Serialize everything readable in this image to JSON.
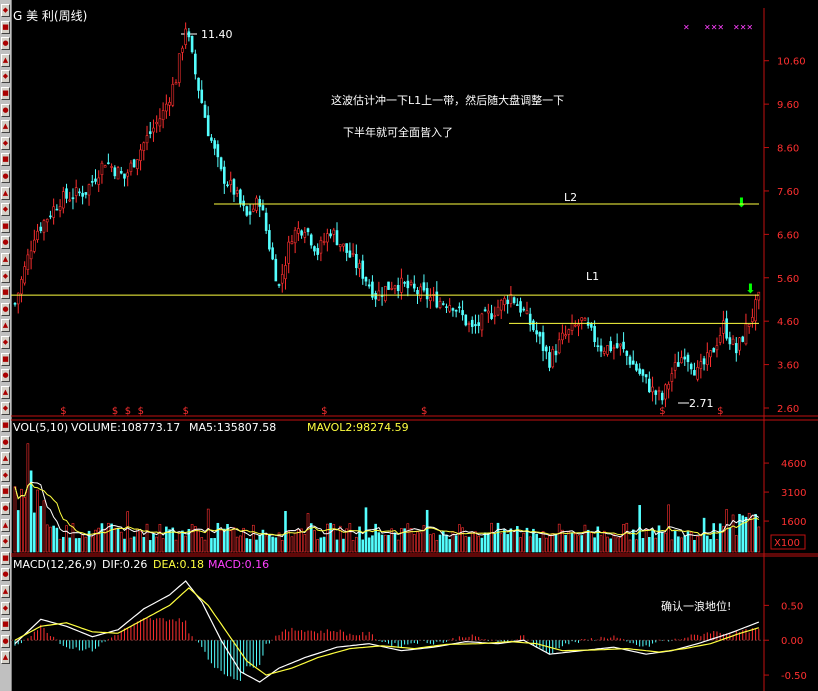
{
  "stock_title": "G 美  利(周线)",
  "price_panel": {
    "peak_label": "11.40",
    "trough_label": "2.71",
    "axis_ticks": [
      "10.60",
      "9.60",
      "8.60",
      "7.60",
      "6.60",
      "5.60",
      "4.60",
      "3.60",
      "2.60"
    ],
    "annotation_line1": "这波估计冲一下L1上一带，然后随大盘调整一下",
    "annotation_line2": "下半年就可全面皆入了",
    "line_labels": {
      "l1": "L1",
      "l2": "L2"
    },
    "marker_glyph": "$"
  },
  "volume_panel": {
    "header_vol": "VOL(5,10)",
    "header_volume": "VOLUME:108773.17",
    "header_ma5": "MA5:135807.58",
    "header_mavol2": "MAVOL2:98274.59",
    "axis_ticks": [
      "4600",
      "3100",
      "1600"
    ],
    "unit_label": "X100"
  },
  "macd_panel": {
    "header_macd": "MACD(12,26,9)",
    "header_dif": "DIF:0.26",
    "header_dea": "DEA:0.18",
    "header_macd_val": "MACD:0.16",
    "axis_ticks": [
      "0.50",
      "0.00",
      "-0.50"
    ],
    "annotation": "确认一浪地位!"
  },
  "colors": {
    "up": "#ff3030",
    "down": "#54ffff",
    "axis": "#c01010",
    "yellow": "#ffff40",
    "white": "#ffffff",
    "magenta": "#ff40ff",
    "green_arrow": "#00ff00"
  },
  "chart_data": {
    "type": "candlestick",
    "price_range": [
      2.6,
      11.4
    ],
    "price_path": [
      [
        0,
        5.0
      ],
      [
        6,
        6.6
      ],
      [
        14,
        7.4
      ],
      [
        22,
        7.6
      ],
      [
        28,
        8.3
      ],
      [
        34,
        7.9
      ],
      [
        40,
        8.7
      ],
      [
        46,
        9.4
      ],
      [
        50,
        10.2
      ],
      [
        53,
        11.4
      ],
      [
        56,
        10.3
      ],
      [
        60,
        9.0
      ],
      [
        64,
        8.0
      ],
      [
        68,
        7.6
      ],
      [
        72,
        7.0
      ],
      [
        76,
        7.4
      ],
      [
        80,
        6.0
      ],
      [
        82,
        5.4
      ],
      [
        86,
        6.6
      ],
      [
        90,
        6.8
      ],
      [
        94,
        6.2
      ],
      [
        98,
        6.7
      ],
      [
        102,
        6.3
      ],
      [
        108,
        5.7
      ],
      [
        112,
        5.2
      ],
      [
        118,
        5.5
      ],
      [
        124,
        5.3
      ],
      [
        130,
        5.1
      ],
      [
        136,
        5.0
      ],
      [
        142,
        4.4
      ],
      [
        148,
        4.8
      ],
      [
        154,
        5.2
      ],
      [
        158,
        4.8
      ],
      [
        162,
        4.3
      ],
      [
        166,
        3.7
      ],
      [
        170,
        4.2
      ],
      [
        176,
        4.6
      ],
      [
        182,
        4.0
      ],
      [
        188,
        4.0
      ],
      [
        194,
        3.4
      ],
      [
        198,
        3.0
      ],
      [
        201,
        2.8
      ],
      [
        204,
        3.4
      ],
      [
        208,
        3.9
      ],
      [
        212,
        3.4
      ],
      [
        216,
        3.8
      ],
      [
        220,
        4.5
      ],
      [
        224,
        3.9
      ],
      [
        228,
        4.6
      ],
      [
        231,
        5.1
      ]
    ],
    "levels": {
      "L1": 5.2,
      "L2": 7.3,
      "support": 4.55
    },
    "volume_range": [
      0,
      6000
    ],
    "macd_range": [
      -0.7,
      0.95
    ],
    "dif_path": [
      [
        0,
        -0.05
      ],
      [
        8,
        0.3
      ],
      [
        16,
        0.2
      ],
      [
        24,
        0.05
      ],
      [
        32,
        0.15
      ],
      [
        40,
        0.45
      ],
      [
        48,
        0.65
      ],
      [
        53,
        0.85
      ],
      [
        58,
        0.55
      ],
      [
        64,
        0.0
      ],
      [
        70,
        -0.45
      ],
      [
        76,
        -0.6
      ],
      [
        82,
        -0.4
      ],
      [
        90,
        -0.25
      ],
      [
        100,
        -0.1
      ],
      [
        110,
        -0.05
      ],
      [
        120,
        -0.15
      ],
      [
        130,
        -0.1
      ],
      [
        140,
        -0.02
      ],
      [
        150,
        -0.05
      ],
      [
        158,
        0.0
      ],
      [
        166,
        -0.2
      ],
      [
        176,
        -0.15
      ],
      [
        186,
        -0.1
      ],
      [
        196,
        -0.2
      ],
      [
        204,
        -0.15
      ],
      [
        212,
        -0.05
      ],
      [
        222,
        0.1
      ],
      [
        231,
        0.26
      ]
    ],
    "dea_path": [
      [
        0,
        0.0
      ],
      [
        8,
        0.2
      ],
      [
        16,
        0.25
      ],
      [
        24,
        0.12
      ],
      [
        32,
        0.1
      ],
      [
        40,
        0.3
      ],
      [
        48,
        0.5
      ],
      [
        54,
        0.75
      ],
      [
        60,
        0.5
      ],
      [
        66,
        0.1
      ],
      [
        72,
        -0.3
      ],
      [
        78,
        -0.5
      ],
      [
        86,
        -0.4
      ],
      [
        94,
        -0.25
      ],
      [
        104,
        -0.12
      ],
      [
        114,
        -0.08
      ],
      [
        124,
        -0.12
      ],
      [
        134,
        -0.06
      ],
      [
        144,
        -0.05
      ],
      [
        154,
        -0.02
      ],
      [
        162,
        -0.05
      ],
      [
        170,
        -0.15
      ],
      [
        180,
        -0.14
      ],
      [
        190,
        -0.12
      ],
      [
        200,
        -0.17
      ],
      [
        208,
        -0.12
      ],
      [
        216,
        -0.05
      ],
      [
        224,
        0.08
      ],
      [
        231,
        0.18
      ]
    ]
  }
}
